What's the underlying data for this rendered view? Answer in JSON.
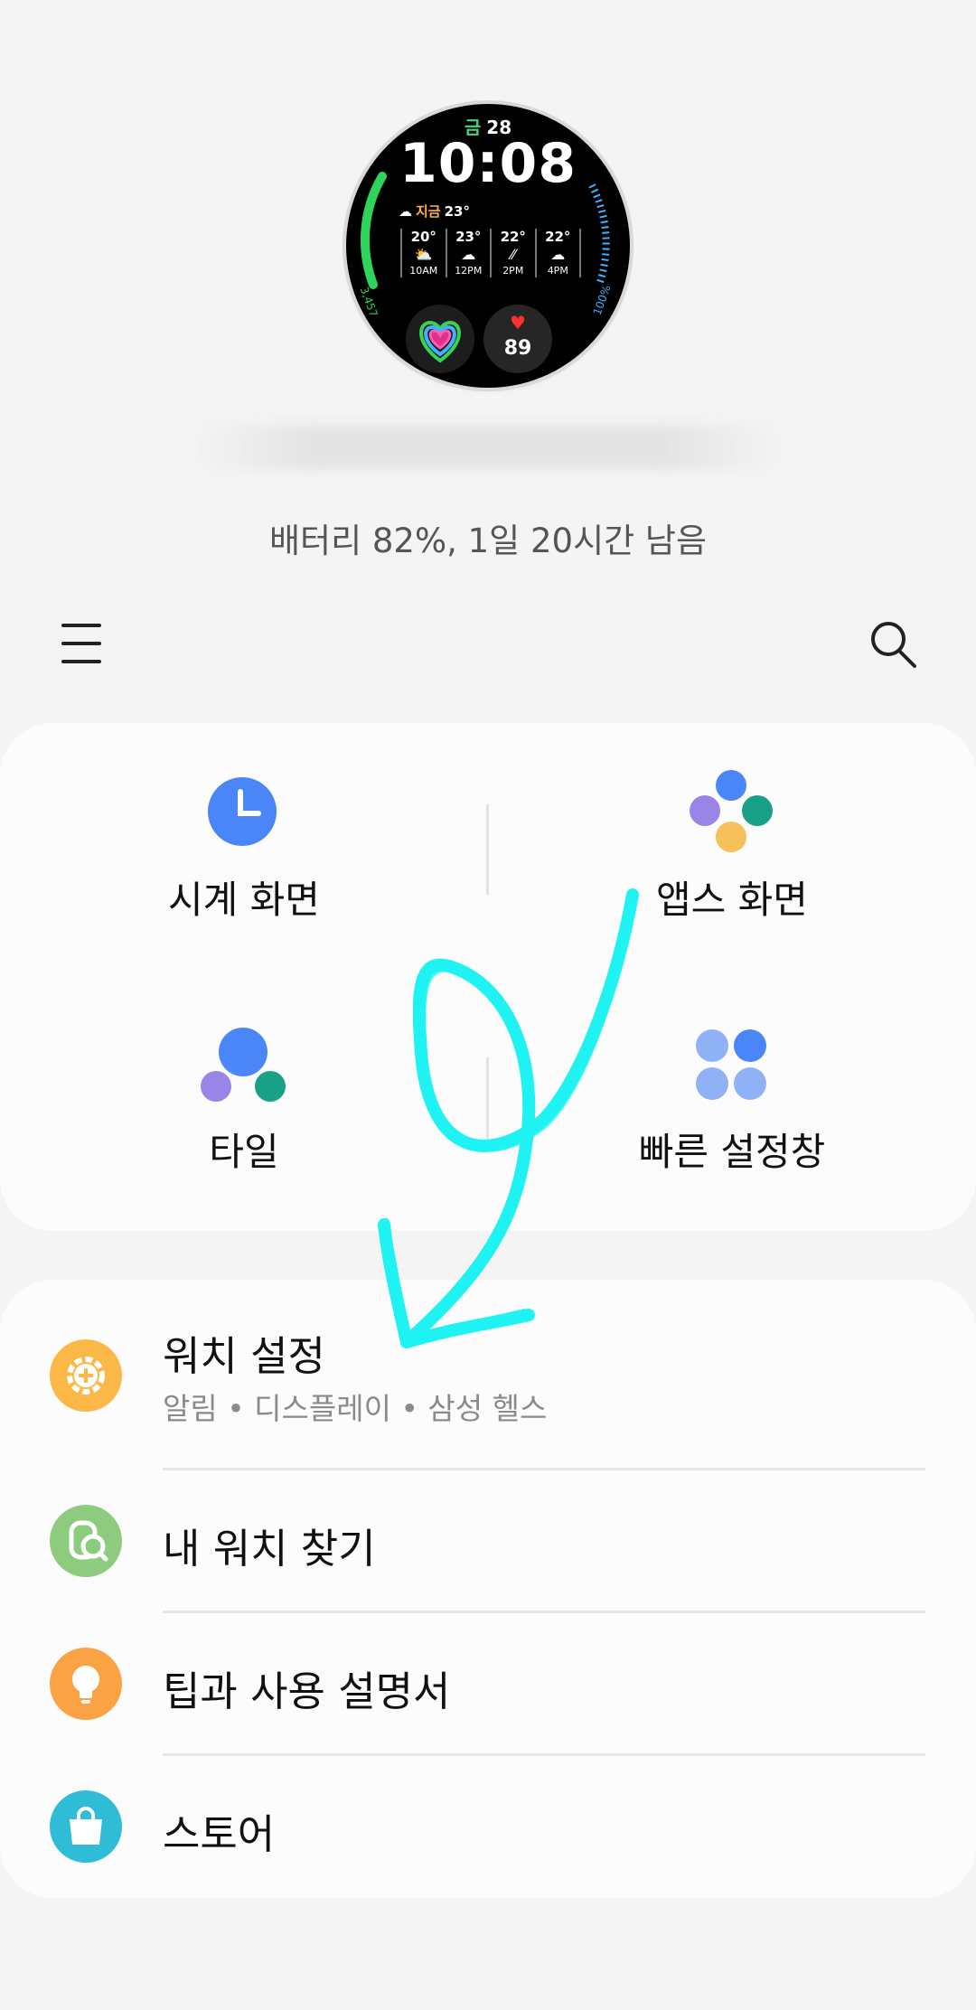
{
  "watch_face": {
    "day": "금",
    "date": "28",
    "time": "10:08",
    "now_label": "지금",
    "now_temp": "23°",
    "forecast": [
      {
        "temp": "20°",
        "icon": "sun-cloud-icon",
        "hour": "10AM"
      },
      {
        "temp": "23°",
        "icon": "cloud-icon",
        "hour": "12PM"
      },
      {
        "temp": "22°",
        "icon": "rain-icon",
        "hour": "2PM"
      },
      {
        "temp": "22°",
        "icon": "cloud-icon",
        "hour": "4PM"
      }
    ],
    "steps": "3,457",
    "battery_pct_label": "100%",
    "heart_rate": "89"
  },
  "battery_status": "배터리 82%, 1일 20시간 남음",
  "toolbar": {
    "menu_icon": "hamburger-menu-icon",
    "search_icon": "search-icon"
  },
  "quick_grid": {
    "items": [
      {
        "label": "시계 화면",
        "icon": "clock-icon",
        "color": "#4a86f7"
      },
      {
        "label": "앱스 화면",
        "icon": "apps-dots-icon",
        "color": "#4a86f7"
      },
      {
        "label": "타일",
        "icon": "tiles-icon",
        "color": "#4a86f7"
      },
      {
        "label": "빠른 설정창",
        "icon": "quick-panel-icon",
        "color": "#4a86f7"
      }
    ]
  },
  "list": {
    "items": [
      {
        "title": "워치 설정",
        "subtitle": "알림 • 디스플레이 • 삼성 헬스",
        "icon": "gear-icon",
        "color": "#fbb847"
      },
      {
        "title": "내 워치 찾기",
        "subtitle": "",
        "icon": "find-watch-icon",
        "color": "#8dcc7f"
      },
      {
        "title": "팁과 사용 설명서",
        "subtitle": "",
        "icon": "lightbulb-icon",
        "color": "#fba244"
      },
      {
        "title": "스토어",
        "subtitle": "",
        "icon": "shopping-bag-icon",
        "color": "#2ebcd6"
      }
    ]
  },
  "colors": {
    "background": "#f4f4f4",
    "card": "#fcfcfc",
    "accent_blue": "#4a86f7",
    "annotation_arrow": "#1ff2f2"
  }
}
